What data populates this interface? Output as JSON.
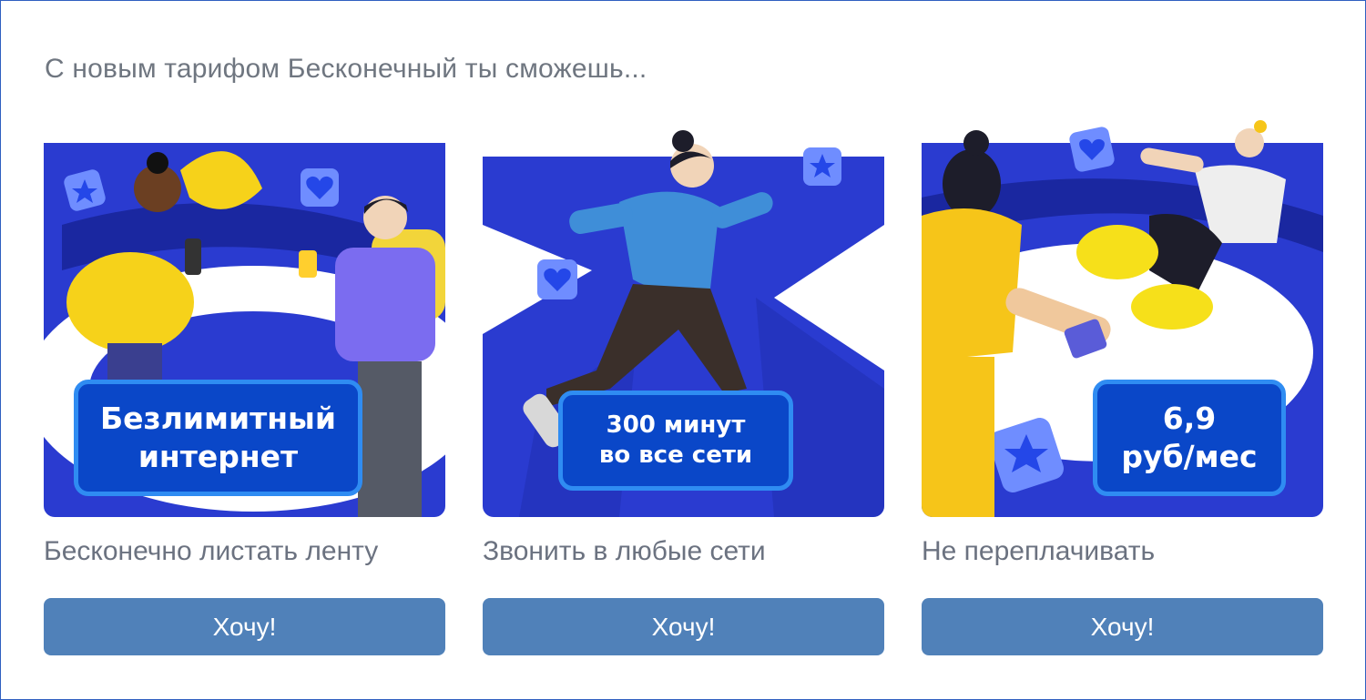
{
  "heading": "С новым тарифом Бесконечный ты сможешь...",
  "cards": [
    {
      "badge_line1": "Безлимитный",
      "badge_line2": "интернет",
      "caption": "Бесконечно листать ленту",
      "button": "Хочу!"
    },
    {
      "badge_line1": "300 минут",
      "badge_line2": "во все сети",
      "caption": "Звонить в любые сети",
      "button": "Хочу!"
    },
    {
      "badge_line1": "6,9",
      "badge_line2": "руб/мес",
      "caption": "Не переплачивать",
      "button": "Хочу!"
    }
  ],
  "colors": {
    "frame_border": "#2f5fc0",
    "art_blue": "#2233c6",
    "badge_bg": "#0a47c8",
    "badge_border": "#2f8cf2",
    "button_bg": "#5081b9",
    "heading_text": "#6f7680"
  },
  "icons": [
    "star-icon",
    "heart-icon"
  ]
}
